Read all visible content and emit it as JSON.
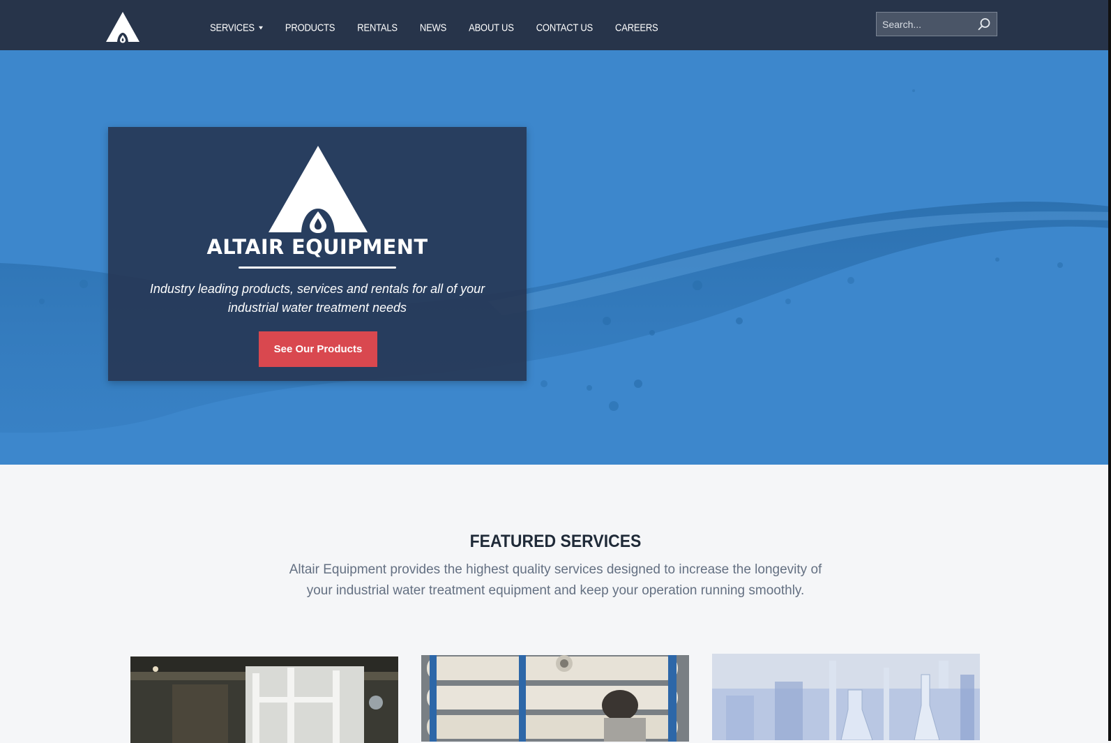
{
  "nav": {
    "items": [
      {
        "label": "SERVICES"
      },
      {
        "label": "PRODUCTS"
      },
      {
        "label": "RENTALS"
      },
      {
        "label": "NEWS"
      },
      {
        "label": "ABOUT US"
      },
      {
        "label": "CONTACT US"
      },
      {
        "label": "CAREERS"
      }
    ],
    "search_placeholder": "Search..."
  },
  "hero": {
    "brand_name": "ALTAIR EQUIPMENT",
    "tagline": "Industry leading products, services and rentals for all of your industrial water treatment needs",
    "cta_label": "See Our Products"
  },
  "featured": {
    "title": "FEATURED SERVICES",
    "description": "Altair Equipment provides the highest quality services designed to increase the longevity of your industrial water treatment equipment and keep your operation running smoothly."
  },
  "colors": {
    "nav_bg": "#27344a",
    "hero_bg": "#3d87cc",
    "card_bg": "#273856",
    "accent": "#d9484f",
    "page_bg": "#f5f6f8"
  },
  "icons": {
    "logo": "altair-logo-icon",
    "search": "search-icon",
    "dropdown": "caret-down-icon"
  }
}
